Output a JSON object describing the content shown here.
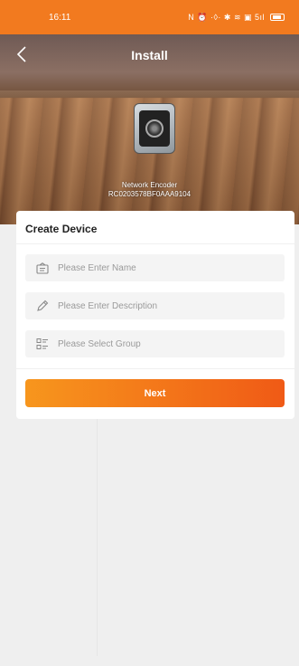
{
  "status_bar": {
    "time": "16:11",
    "indicators": "N ⏰ ·◊· ✱ ≋ ▣ 5ıl"
  },
  "header": {
    "title": "Install",
    "back_icon": "chevron-left-icon"
  },
  "device": {
    "type": "Network Encoder",
    "serial": "RC0203578BF0AAA9104"
  },
  "form": {
    "title": "Create Device",
    "name_placeholder": "Please Enter Name",
    "description_placeholder": "Please Enter Description",
    "group_placeholder": "Please Select Group",
    "next_label": "Next"
  },
  "colors": {
    "accent": "#f27a1f",
    "button_start": "#f7961d",
    "button_end": "#f05a16"
  }
}
